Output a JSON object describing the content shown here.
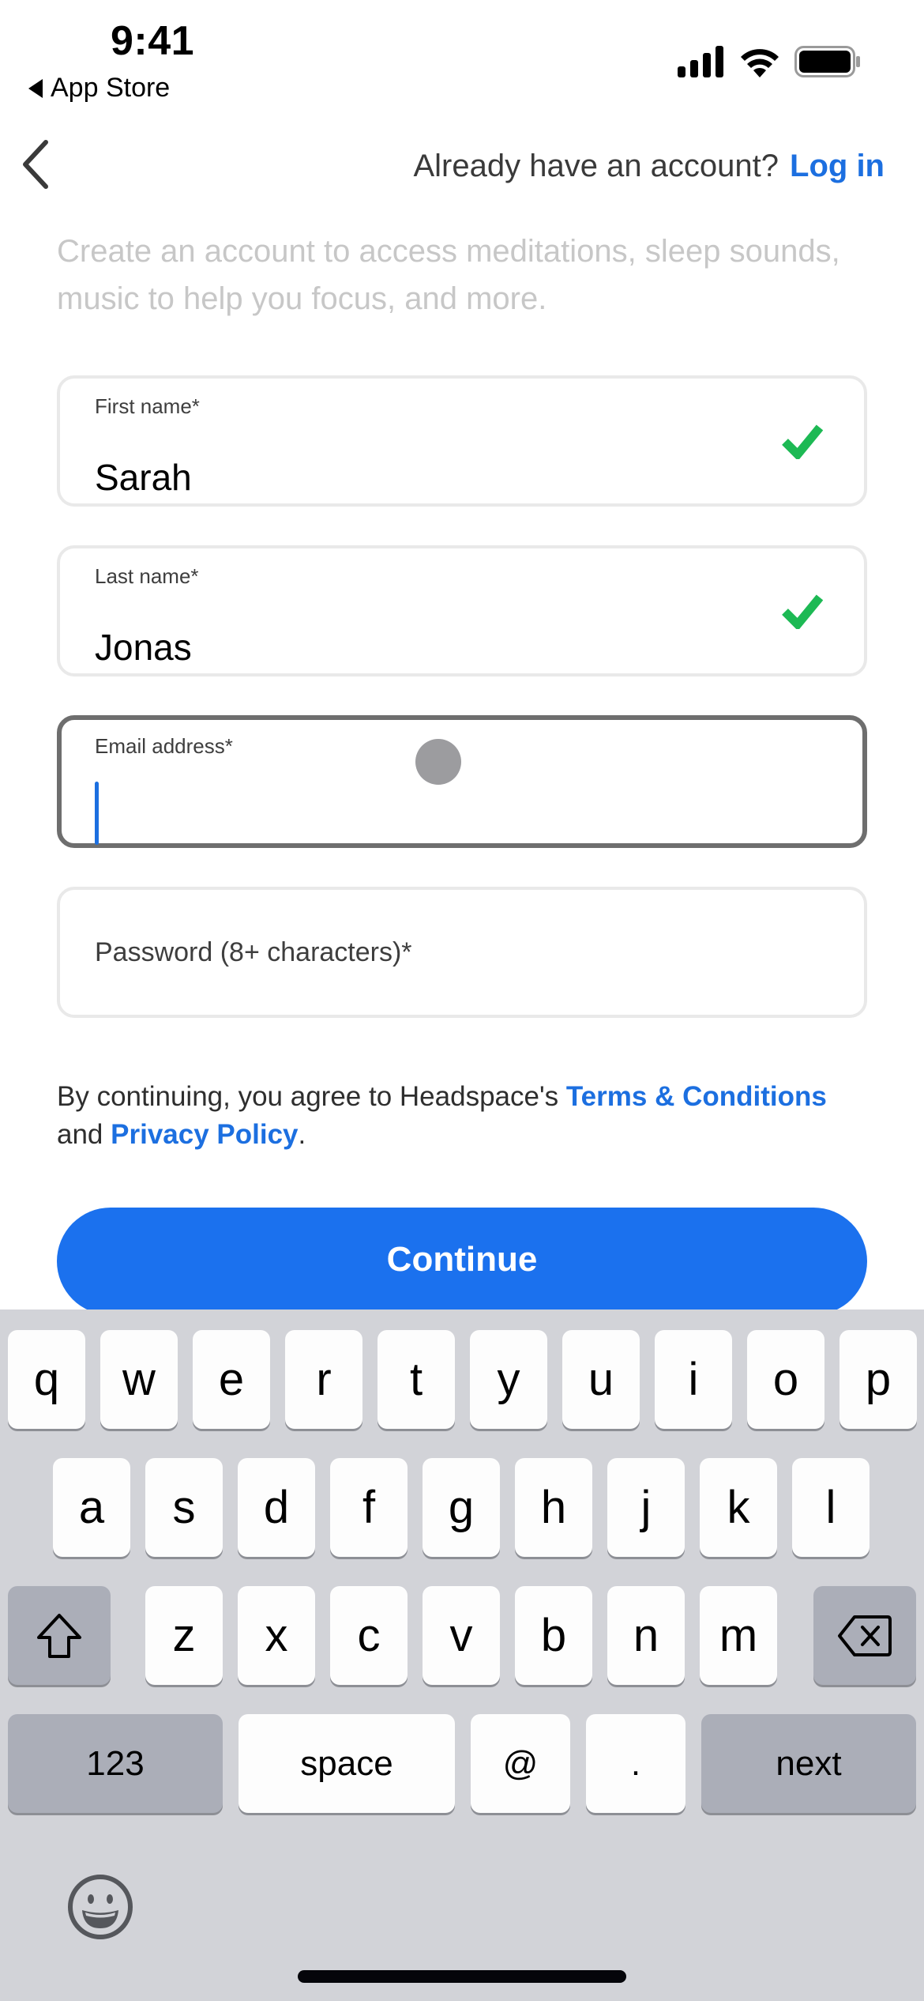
{
  "status_bar": {
    "time": "9:41",
    "back_app_label": "App Store",
    "icons": [
      "signal-icon",
      "wifi-icon",
      "battery-icon"
    ]
  },
  "nav": {
    "back_icon": "chevron-left-icon",
    "prompt": "Already have an account?",
    "login_label": "Log in"
  },
  "subtitle": "Create an account to access meditations, sleep sounds, music to help you focus, and more.",
  "form": {
    "first_name": {
      "label": "First name*",
      "value": "Sarah",
      "valid": true
    },
    "last_name": {
      "label": "Last name*",
      "value": "Jonas",
      "valid": true
    },
    "email": {
      "label": "Email address*",
      "value": "",
      "focused": true
    },
    "password": {
      "placeholder": "Password (8+ characters)*",
      "value": ""
    }
  },
  "terms": {
    "prefix": "By continuing, you agree to Headspace's",
    "terms_link": "Terms & Conditions",
    "middle": "and",
    "privacy_link": "Privacy Policy",
    "suffix": "."
  },
  "continue_label": "Continue",
  "colors": {
    "accent": "#1b71ee",
    "link": "#1c6fe0",
    "valid_check": "#1db954",
    "keyboard_bg": "#d2d3d8"
  },
  "keyboard": {
    "row1": [
      "q",
      "w",
      "e",
      "r",
      "t",
      "y",
      "u",
      "i",
      "o",
      "p"
    ],
    "row2": [
      "a",
      "s",
      "d",
      "f",
      "g",
      "h",
      "j",
      "k",
      "l"
    ],
    "row3": [
      "z",
      "x",
      "c",
      "v",
      "b",
      "n",
      "m"
    ],
    "numbers_label": "123",
    "space_label": "space",
    "at_label": "@",
    "dot_label": ".",
    "return_label": "next",
    "shift_icon": "shift-arrow-icon",
    "delete_icon": "backspace-icon",
    "emoji_icon": "emoji-smiley-icon"
  }
}
